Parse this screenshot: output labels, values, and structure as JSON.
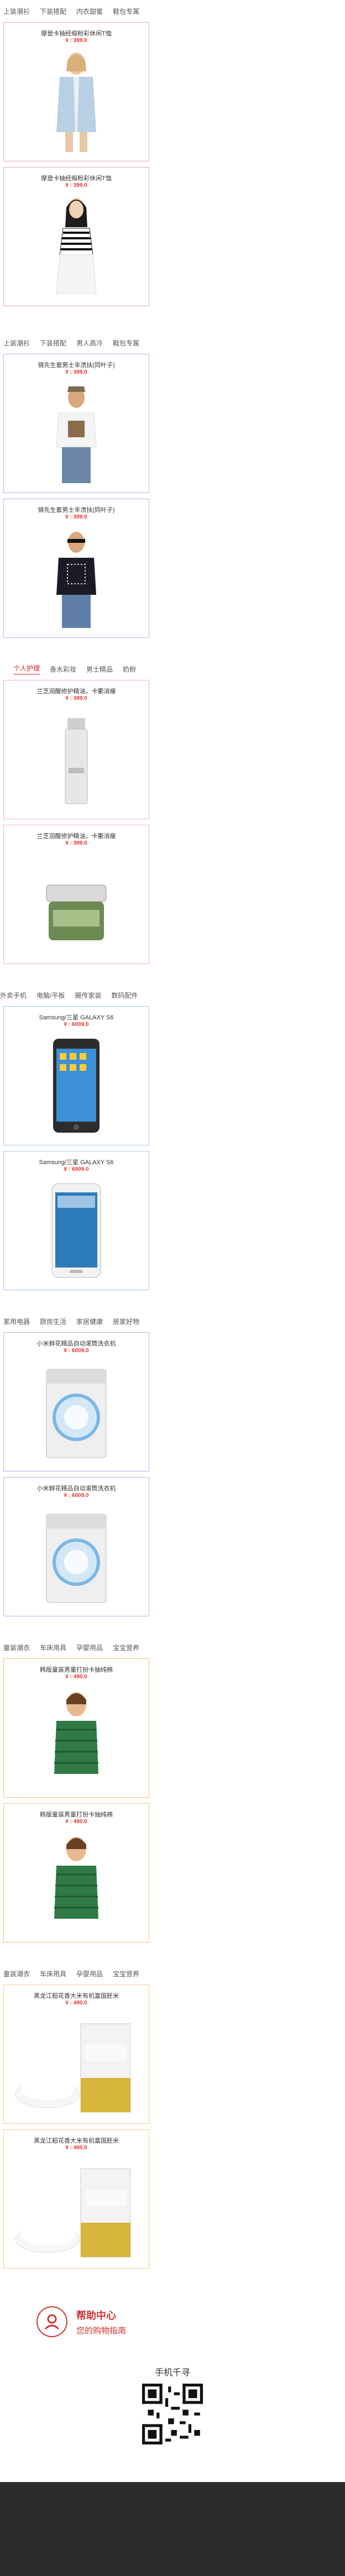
{
  "sections": [
    {
      "tabs": [
        "上装潮衫",
        "下装搭配",
        "内衣甜蜜",
        "鞋包专属"
      ],
      "active": -1,
      "products": [
        {
          "title": "摩登卡抽经缎粉彩休闲T恤",
          "price": "¥ : 399.0"
        },
        {
          "title": "摩登卡抽经缎粉彩休闲T恤",
          "price": "¥ : 399.0"
        }
      ]
    },
    {
      "tabs": [
        "上装潮衫",
        "下装搭配",
        "男人高冷",
        "鞋包专属"
      ],
      "active": -1,
      "products": [
        {
          "title": "锦先生套男士丰渍扶(同叶子)",
          "price": "¥ : 399.0"
        },
        {
          "title": "锦先生套男士丰渍扶(同叶子)",
          "price": "¥ : 399.0"
        }
      ]
    },
    {
      "tabs": [
        "个人护理",
        "香水彩妆",
        "男士精品",
        "奶粉"
      ],
      "active": 0,
      "products": [
        {
          "title": "兰芝润醒修护精油，卡衢消瘦",
          "price": "¥ : 399.0"
        },
        {
          "title": "兰芝润醒修护精油，卡衢消瘦",
          "price": "¥ : 399.0"
        }
      ]
    },
    {
      "tabs": [
        "外卖手机",
        "电脑/平板",
        "摄传家装",
        "数码配件"
      ],
      "active": -1,
      "products": [
        {
          "title": "Samsung/三星 GALAXY S6",
          "price": "¥ : 6009.0"
        },
        {
          "title": "Samsung/三星 GALAXY S6",
          "price": "¥ : 6009.0"
        }
      ]
    },
    {
      "tabs": [
        "家用电器",
        "厨房生活",
        "家居健康",
        "居家好物"
      ],
      "active": -1,
      "products": [
        {
          "title": "小米鲜花精品自动滚筒洗衣机",
          "price": "¥ : 6009.0"
        },
        {
          "title": "小米鲜花精品自动滚筒洗衣机",
          "price": "¥ : 6009.0"
        }
      ]
    },
    {
      "tabs": [
        "童装潮衣",
        "车床用具",
        "孕婴用品",
        "宝宝营养"
      ],
      "active": -1,
      "products": [
        {
          "title": "韩版童装男童打扮卡抽纯棉",
          "price": "¥ : 490.0"
        },
        {
          "title": "韩版童装男童打扮卡抽纯棉",
          "price": "¥ : 490.0"
        }
      ]
    },
    {
      "tabs": [
        "童装潮衣",
        "车床用具",
        "孕婴用品",
        "宝宝营养"
      ],
      "active": -1,
      "products": [
        {
          "title": "黑龙江稻花香大米有机富国胚米",
          "price": "¥ : 490.0"
        },
        {
          "title": "黑龙江稻花香大米有机富国胚米",
          "price": "¥ : 490.0"
        }
      ]
    }
  ],
  "help": {
    "title": "帮助中心",
    "subtitle": "您的购物指南",
    "icon": "user-circle-icon"
  },
  "mobile": {
    "title": "手机千寻"
  }
}
